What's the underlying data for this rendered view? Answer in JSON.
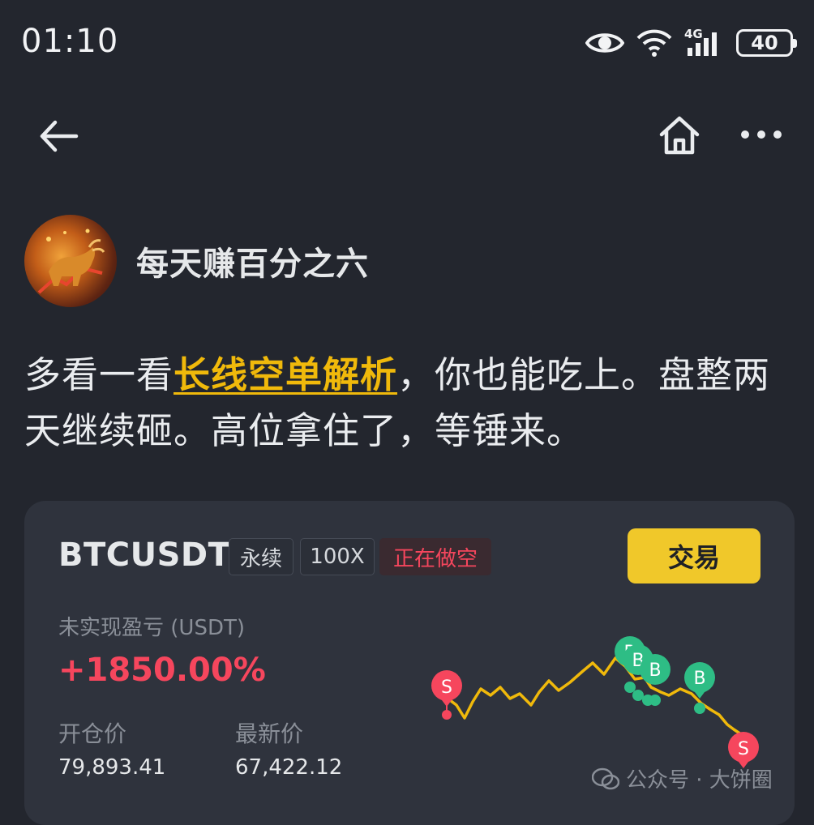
{
  "status_bar": {
    "time": "01:10",
    "network": "4G",
    "battery": "40"
  },
  "nav": {
    "back_icon": "arrow-left-icon",
    "home_icon": "home-icon",
    "more_icon": "more-dots-icon"
  },
  "author": {
    "name": "每天赚百分之六"
  },
  "post": {
    "text_before": "多看一看",
    "link_text": "长线空单解析",
    "text_after": "，你也能吃上。盘整两天继续砸。高位拿住了，等锤来。"
  },
  "position_card": {
    "symbol": "BTCUSDT",
    "tags": [
      "永续",
      "100X",
      "正在做空"
    ],
    "trade_button": "交易",
    "pnl_label": "未实现盈亏 (USDT)",
    "pnl_value": "+1850.00%",
    "entry_price_label": "开仓价",
    "entry_price": "79,893.41",
    "last_price_label": "最新价",
    "last_price": "67,422.12",
    "colors": {
      "accent": "#f0c82a",
      "short": "#f6465d",
      "buy_marker": "#2ebd85",
      "line": "#f0b90b"
    }
  },
  "watermark": {
    "text": "公众号 · 大饼圈"
  }
}
